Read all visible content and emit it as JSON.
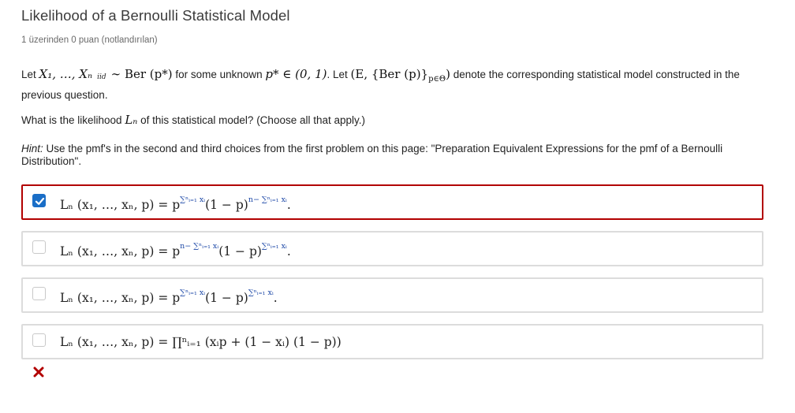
{
  "header": {
    "title": "Likelihood of a Bernoulli Statistical Model",
    "points": "1 üzerinden 0 puan (notlandırılan)"
  },
  "problem": {
    "p1_let": "Let",
    "p1_math1": "X₁, …, Xₙ",
    "p1_iid": "iid",
    "p1_dist": "∼ Ber (p*)",
    "p1_mid": " for some unknown ",
    "p1_math2": "p* ∈ (0, 1)",
    "p1_mid2": ". Let ",
    "p1_math3": "(E, {Ber (p)}",
    "p1_math3_sub": "p∈Θ",
    "p1_math3_end": ")",
    "p1_tail": " denote the corresponding statistical model constructed in the previous question.",
    "p2_pre": "What is the likelihood ",
    "p2_math": "Lₙ",
    "p2_post": " of this statistical model? (Choose all that apply.)",
    "hint_label": "Hint:",
    "hint_text": " Use the pmf's in the second and third choices from the first problem on this page: \"Preparation Equivalent Expressions for the pmf of a Bernoulli Distribution\"."
  },
  "choices": [
    {
      "checked": true,
      "lhs": "Lₙ (x₁, …, xₙ, p) = p",
      "exp1": "∑ⁿᵢ₌₁ xᵢ",
      "mid": "(1 − p)",
      "exp2": "n− ∑ⁿᵢ₌₁ xᵢ",
      "end": "."
    },
    {
      "checked": false,
      "lhs": "Lₙ (x₁, …, xₙ, p) = p",
      "exp1": "n− ∑ⁿᵢ₌₁ xᵢ",
      "mid": "(1 − p)",
      "exp2": "∑ⁿᵢ₌₁ xᵢ",
      "end": "."
    },
    {
      "checked": false,
      "lhs": "Lₙ (x₁, …, xₙ, p) = p",
      "exp1": "∑ⁿᵢ₌₁ xᵢ",
      "mid": "(1 − p)",
      "exp2": "∑ⁿᵢ₌₁ xᵢ",
      "end": "."
    },
    {
      "checked": false,
      "lhs": "Lₙ (x₁, …, xₙ, p) = ∏ⁿᵢ₌₁ (xᵢp + (1 − xᵢ) (1 − p))",
      "exp1": "",
      "mid": "",
      "exp2": "",
      "end": ""
    }
  ],
  "status": {
    "icon": "incorrect-x-icon",
    "color": "#b20000"
  },
  "colors": {
    "selected_border": "#b20000",
    "checkbox_checked": "#1a6ec7",
    "exponent_highlight": "#1f4aa8"
  }
}
